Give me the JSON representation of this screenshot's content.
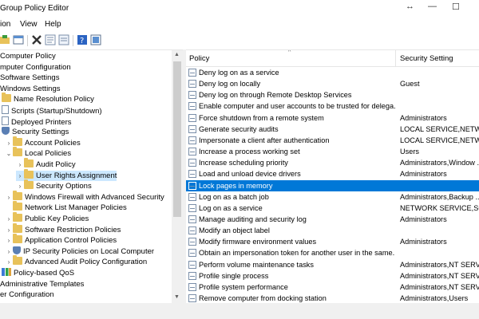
{
  "window": {
    "title": "Group Policy Editor"
  },
  "menu": [
    "ion",
    "View",
    "Help"
  ],
  "tree": {
    "items": [
      {
        "label": "Computer Policy",
        "indent": 0,
        "chev": "",
        "icon": "none"
      },
      {
        "label": "mputer Configuration",
        "indent": 0,
        "chev": "",
        "icon": "none"
      },
      {
        "label": "Software Settings",
        "indent": 0,
        "chev": "",
        "icon": "none"
      },
      {
        "label": "Windows Settings",
        "indent": 0,
        "chev": "",
        "icon": "none"
      },
      {
        "label": "Name Resolution Policy",
        "indent": 1,
        "chev": "",
        "icon": "folder"
      },
      {
        "label": "Scripts (Startup/Shutdown)",
        "indent": 1,
        "chev": "",
        "icon": "doc"
      },
      {
        "label": "Deployed Printers",
        "indent": 1,
        "chev": "",
        "icon": "doc"
      },
      {
        "label": "Security Settings",
        "indent": 1,
        "chev": "",
        "icon": "shield"
      },
      {
        "label": "Account Policies",
        "indent": 2,
        "chev": ">",
        "icon": "folder"
      },
      {
        "label": "Local Policies",
        "indent": 2,
        "chev": "v",
        "icon": "folder"
      },
      {
        "label": "Audit Policy",
        "indent": 3,
        "chev": ">",
        "icon": "folder"
      },
      {
        "label": "User Rights Assignment",
        "indent": 3,
        "chev": ">",
        "icon": "folder",
        "selected": true
      },
      {
        "label": "Security Options",
        "indent": 3,
        "chev": ">",
        "icon": "folder"
      },
      {
        "label": "Windows Firewall with Advanced Security",
        "indent": 2,
        "chev": ">",
        "icon": "folder"
      },
      {
        "label": "Network List Manager Policies",
        "indent": 2,
        "chev": "",
        "icon": "folder"
      },
      {
        "label": "Public Key Policies",
        "indent": 2,
        "chev": ">",
        "icon": "folder"
      },
      {
        "label": "Software Restriction Policies",
        "indent": 2,
        "chev": ">",
        "icon": "folder"
      },
      {
        "label": "Application Control Policies",
        "indent": 2,
        "chev": ">",
        "icon": "folder"
      },
      {
        "label": "IP Security Policies on Local Computer",
        "indent": 2,
        "chev": ">",
        "icon": "shield"
      },
      {
        "label": "Advanced Audit Policy Configuration",
        "indent": 2,
        "chev": ">",
        "icon": "folder"
      },
      {
        "label": "Policy-based QoS",
        "indent": 1,
        "chev": "",
        "icon": "chart"
      },
      {
        "label": "Administrative Templates",
        "indent": 0,
        "chev": "",
        "icon": "none"
      },
      {
        "label": "er Configuration",
        "indent": 0,
        "chev": "",
        "icon": "none"
      }
    ]
  },
  "list": {
    "col_policy": "Policy",
    "col_setting": "Security Setting",
    "rows": [
      {
        "policy": "Deny log on as a service",
        "setting": ""
      },
      {
        "policy": "Deny log on locally",
        "setting": "Guest"
      },
      {
        "policy": "Deny log on through Remote Desktop Services",
        "setting": ""
      },
      {
        "policy": "Enable computer and user accounts to be trusted for delega...",
        "setting": ""
      },
      {
        "policy": "Force shutdown from a remote system",
        "setting": "Administrators"
      },
      {
        "policy": "Generate security audits",
        "setting": "LOCAL SERVICE,NETWO..."
      },
      {
        "policy": "Impersonate a client after authentication",
        "setting": "LOCAL SERVICE,NETWO..."
      },
      {
        "policy": "Increase a process working set",
        "setting": "Users"
      },
      {
        "policy": "Increase scheduling priority",
        "setting": "Administrators,Window ..."
      },
      {
        "policy": "Load and unload device drivers",
        "setting": "Administrators"
      },
      {
        "policy": "Lock pages in memory",
        "setting": "",
        "selected": true
      },
      {
        "policy": "Log on as a batch job",
        "setting": "Administrators,Backup ..."
      },
      {
        "policy": "Log on as a service",
        "setting": "NETWORK SERVICE,SQL..."
      },
      {
        "policy": "Manage auditing and security log",
        "setting": "Administrators"
      },
      {
        "policy": "Modify an object label",
        "setting": ""
      },
      {
        "policy": "Modify firmware environment values",
        "setting": "Administrators"
      },
      {
        "policy": "Obtain an impersonation token for another user in the same...",
        "setting": ""
      },
      {
        "policy": "Perform volume maintenance tasks",
        "setting": "Administrators,NT SERVI..."
      },
      {
        "policy": "Profile single process",
        "setting": "Administrators,NT SERVI..."
      },
      {
        "policy": "Profile system performance",
        "setting": "Administrators,NT SERVI..."
      },
      {
        "policy": "Remove computer from docking station",
        "setting": "Administrators,Users"
      }
    ]
  },
  "colors": {
    "selection": "#0078d7",
    "tree_selection": "#cce8ff",
    "folder": "#e8c25a"
  }
}
